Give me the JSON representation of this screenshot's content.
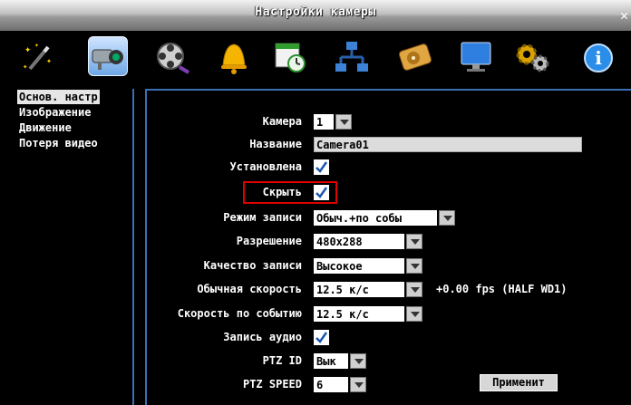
{
  "window": {
    "title": "Настройки камеры",
    "close": "✕"
  },
  "toolbar": {
    "icons": [
      "wizard-wand-icon",
      "camera-icon",
      "film-reel-icon",
      "alarm-bell-icon",
      "schedule-icon",
      "network-icon",
      "storage-disk-icon",
      "monitor-icon",
      "system-gears-icon",
      "info-icon"
    ]
  },
  "sidebar": {
    "items": [
      {
        "label": "Основ. настр",
        "selected": true
      },
      {
        "label": "Изображение"
      },
      {
        "label": "Движение"
      },
      {
        "label": "Потеря видео"
      }
    ]
  },
  "form": {
    "camera": {
      "label": "Камера",
      "value": "1"
    },
    "name": {
      "label": "Название",
      "value": "Camera01"
    },
    "installed": {
      "label": "Установлена",
      "checked": true
    },
    "hide": {
      "label": "Скрыть",
      "checked": true
    },
    "record_mode": {
      "label": "Режим записи",
      "value": "Обыч.+по собы"
    },
    "resolution": {
      "label": "Разрешение",
      "value": "480x288"
    },
    "quality": {
      "label": "Качество записи",
      "value": "Высокое"
    },
    "normal_speed": {
      "label": "Обычная скорость",
      "value": "12.5 к/с",
      "info": "+0.00 fps (HALF WD1)"
    },
    "event_speed": {
      "label": "Скорость по событию",
      "value": "12.5 к/с"
    },
    "audio": {
      "label": "Запись аудио",
      "checked": true
    },
    "ptz_id": {
      "label": "PTZ ID",
      "value": "Вык"
    },
    "ptz_speed": {
      "label": "PTZ SPEED",
      "value": "6"
    },
    "apply_label": "Применит"
  },
  "colors": {
    "accent_border": "#3a6fb4",
    "highlight": "#e00000"
  }
}
